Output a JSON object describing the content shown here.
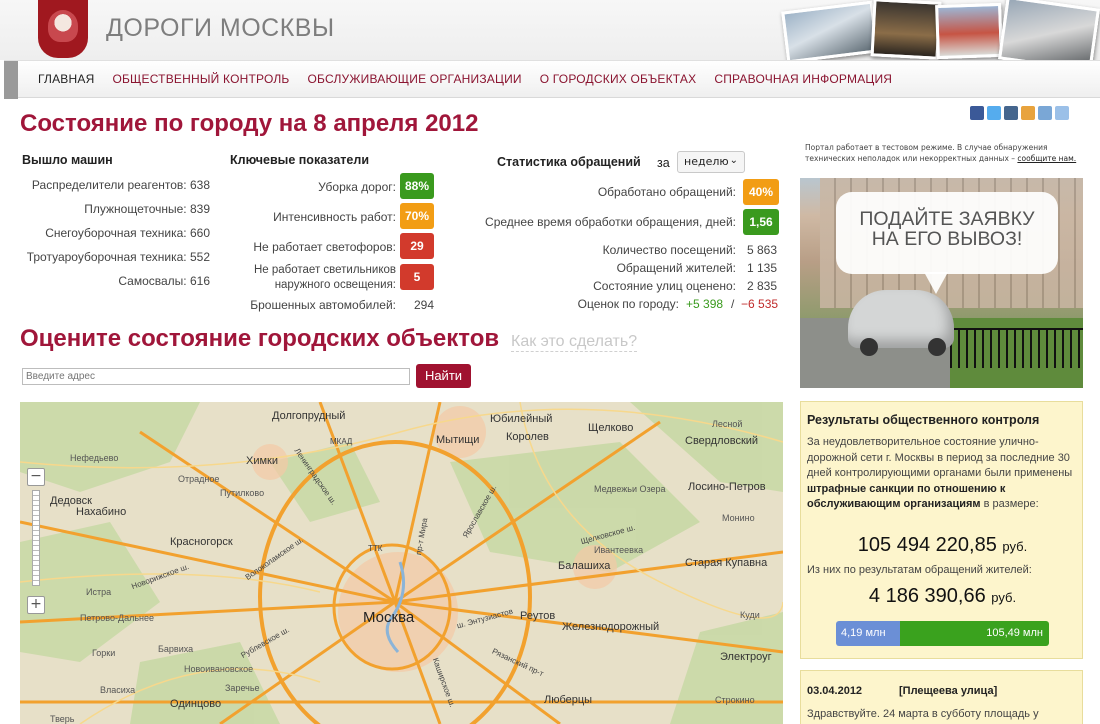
{
  "site": {
    "title": "ДОРОГИ МОСКВЫ"
  },
  "nav": [
    {
      "label": "ГЛАВНАЯ",
      "active": true
    },
    {
      "label": "ОБЩЕСТВЕННЫЙ КОНТРОЛЬ"
    },
    {
      "label": "ОБСЛУЖИВАЮЩИЕ ОРГАНИЗАЦИИ"
    },
    {
      "label": "О ГОРОДСКИХ ОБЪЕКТАХ"
    },
    {
      "label": "СПРАВОЧНАЯ ИНФОРМАЦИЯ"
    }
  ],
  "main_title": "Состояние по городу на 8 апреля 2012",
  "machines": {
    "title": "Вышло машин",
    "items": [
      {
        "label": "Распределители реагентов:",
        "value": "638"
      },
      {
        "label": "Плужнощеточные:",
        "value": "839"
      },
      {
        "label": "Снегоуборочная техника:",
        "value": "660"
      },
      {
        "label": "Тротуароуборочная техника:",
        "value": "552"
      },
      {
        "label": "Самосвалы:",
        "value": "616"
      }
    ]
  },
  "indicators": {
    "title": "Ключевые показатели",
    "items": [
      {
        "label": "Уборка дорог:",
        "value": "88%",
        "status": "good"
      },
      {
        "label": "Интенсивность работ:",
        "value": "70%",
        "status": "warn"
      },
      {
        "label": "Не работает светофоров:",
        "value": "29",
        "status": "bad"
      },
      {
        "label1": "Не работает светильников",
        "label2": "наружного освещения:",
        "value": "5",
        "status": "bad"
      }
    ],
    "abandoned_label": "Брошенных автомобилей:",
    "abandoned_value": "294"
  },
  "requests": {
    "title": "Статистика обращений",
    "period_prefix": "за",
    "period": "неделю",
    "processed_label": "Обработано обращений:",
    "processed_value": "40%",
    "avg_time_label": "Среднее время обработки обращения, дней:",
    "avg_time_value": "1,56",
    "items": [
      {
        "label": "Количество посещений:",
        "value": "5 863"
      },
      {
        "label": "Обращений жителей:",
        "value": "1 135"
      },
      {
        "label": "Состояние улиц оценено:",
        "value": "2 835"
      }
    ],
    "rating_label": "Оценок по городу:",
    "rating_plus": "+5 398",
    "rating_sep": "/",
    "rating_minus": "−6 535"
  },
  "evaluate": {
    "title": "Оцените состояние городских объектов",
    "howto": "Как это сделать?",
    "address_placeholder": "Введите адрес",
    "find_label": "Найти"
  },
  "map": {
    "labels": [
      {
        "t": "Долгопрудный"
      },
      {
        "t": "Юбилейный"
      },
      {
        "t": "Королев"
      },
      {
        "t": "Щелково"
      },
      {
        "t": "Лесной"
      },
      {
        "t": "Свердловский"
      },
      {
        "t": "Мытищи"
      },
      {
        "t": "Химки"
      },
      {
        "t": "Нефедьево"
      },
      {
        "t": "Отрадное"
      },
      {
        "t": "Путилково"
      },
      {
        "t": "Дедовск"
      },
      {
        "t": "Нахабино"
      },
      {
        "t": "Медвежьи Озера"
      },
      {
        "t": "Лосино-Петров"
      },
      {
        "t": "Монино"
      },
      {
        "t": "Красногорск"
      },
      {
        "t": "Ивантеевка"
      },
      {
        "t": "Балашиха"
      },
      {
        "t": "Старая Купавна"
      },
      {
        "t": "Истра"
      },
      {
        "t": "Петрово-Дальнее"
      },
      {
        "t": "Реутов"
      },
      {
        "t": "Москва"
      },
      {
        "t": "Железнодорожный"
      },
      {
        "t": "Горки"
      },
      {
        "t": "Барвиха"
      },
      {
        "t": "Новоивановское"
      },
      {
        "t": "Электроуг"
      },
      {
        "t": "Власиха"
      },
      {
        "t": "Заречье"
      },
      {
        "t": "Одинцово"
      },
      {
        "t": "Люберцы"
      },
      {
        "t": "Тверь"
      },
      {
        "t": "Строкино"
      },
      {
        "t": "Куди"
      }
    ],
    "roads": [
      "МКАД",
      "ТТК",
      "Ленинградское ш.",
      "Ярославское ш.",
      "Щелковское ш.",
      "пр-т Мира",
      "Рублевское ш.",
      "Новорижское ш.",
      "Волоколамское ш.",
      "ш. Энтузиастов",
      "Рязанский пр-т",
      "Каширское ш."
    ]
  },
  "notice": {
    "text": "Портал работает в тестовом режиме. В случае обнаружения технических неполадок или некорректных данных –",
    "link": "сообщите нам."
  },
  "ad": {
    "line1": "ПОДАЙТЕ ЗАЯВКУ",
    "line2": "НА ЕГО ВЫВОЗ!"
  },
  "results": {
    "title": "Результаты общественного контроля",
    "text1": "За неудовлетворительное состояние улично-дорожной сети г. Москвы в период",
    "text2": "за последние 30 дней контролирующими органами были применены",
    "bold": "штрафные санкции по отношению к обслуживающим организациям",
    "text3": "в размере:",
    "amount_total": "105 494 220,85",
    "currency": "руб.",
    "sub_text": "Из них по результатам обращений жителей:",
    "amount_citizen": "4 186 390,66",
    "bar_left": "4,19 млн",
    "bar_right": "105,49 млн",
    "bar_left_share": 0.04
  },
  "news": {
    "date": "03.04.2012",
    "street": "[Плещеева улица]",
    "text": "Здравствуйте. 24 марта в субботу площадь у"
  }
}
